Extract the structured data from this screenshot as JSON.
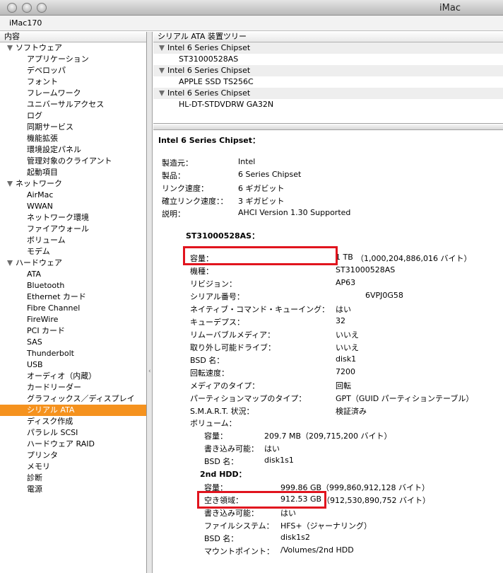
{
  "window": {
    "title": "iMac"
  },
  "machine_name": "iMac170",
  "sidebar": {
    "header": "内容",
    "rows": [
      {
        "type": "section",
        "label": "ソフトウェア"
      },
      {
        "type": "item",
        "label": "アプリケーション"
      },
      {
        "type": "item",
        "label": "デベロッパ"
      },
      {
        "type": "item",
        "label": "フォント"
      },
      {
        "type": "item",
        "label": "フレームワーク"
      },
      {
        "type": "item",
        "label": "ユニバーサルアクセス"
      },
      {
        "type": "item",
        "label": "ログ"
      },
      {
        "type": "item",
        "label": "同期サービス"
      },
      {
        "type": "item",
        "label": "機能拡張"
      },
      {
        "type": "item",
        "label": "環境設定パネル"
      },
      {
        "type": "item",
        "label": "管理対象のクライアント"
      },
      {
        "type": "item",
        "label": "起動項目"
      },
      {
        "type": "section",
        "label": "ネットワーク"
      },
      {
        "type": "item",
        "label": "AirMac"
      },
      {
        "type": "item",
        "label": "WWAN"
      },
      {
        "type": "item",
        "label": "ネットワーク環境"
      },
      {
        "type": "item",
        "label": "ファイアウォール"
      },
      {
        "type": "item",
        "label": "ボリューム"
      },
      {
        "type": "item",
        "label": "モデム"
      },
      {
        "type": "section",
        "label": "ハードウェア"
      },
      {
        "type": "item",
        "label": "ATA"
      },
      {
        "type": "item",
        "label": "Bluetooth"
      },
      {
        "type": "item",
        "label": "Ethernet カード"
      },
      {
        "type": "item",
        "label": "Fibre Channel"
      },
      {
        "type": "item",
        "label": "FireWire"
      },
      {
        "type": "item",
        "label": "PCI カード"
      },
      {
        "type": "item",
        "label": "SAS"
      },
      {
        "type": "item",
        "label": "Thunderbolt"
      },
      {
        "type": "item",
        "label": "USB"
      },
      {
        "type": "item",
        "label": "オーディオ（内蔵）"
      },
      {
        "type": "item",
        "label": "カードリーダー"
      },
      {
        "type": "item",
        "label": "グラフィックス／ディスプレイ"
      },
      {
        "type": "item",
        "label": "シリアル ATA",
        "selected": true
      },
      {
        "type": "item",
        "label": "ディスク作成"
      },
      {
        "type": "item",
        "label": "パラレル SCSI"
      },
      {
        "type": "item",
        "label": "ハードウェア RAID"
      },
      {
        "type": "item",
        "label": "プリンタ"
      },
      {
        "type": "item",
        "label": "メモリ"
      },
      {
        "type": "item",
        "label": "診断"
      },
      {
        "type": "item",
        "label": "電源"
      }
    ]
  },
  "device_tree": {
    "header": "シリアル ATA 装置ツリー",
    "rows": [
      {
        "type": "chip",
        "label": "Intel 6 Series Chipset"
      },
      {
        "type": "dev",
        "label": "ST31000528AS"
      },
      {
        "type": "chip",
        "label": "Intel 6 Series Chipset"
      },
      {
        "type": "dev",
        "label": "APPLE SSD TS256C"
      },
      {
        "type": "chip",
        "label": "Intel 6 Series Chipset"
      },
      {
        "type": "dev",
        "label": "HL-DT-STDVDRW  GA32N"
      }
    ]
  },
  "detail": {
    "title": "Intel 6 Series Chipset：",
    "chipset_props": [
      {
        "k": "製造元：",
        "v": "Intel"
      },
      {
        "k": "製品：",
        "v": "6 Series Chipset"
      },
      {
        "k": "リンク速度：",
        "v": "6 ギガビット"
      },
      {
        "k": "確立リンク速度：：",
        "v": "3 ギガビット"
      },
      {
        "k": "説明：",
        "v": "AHCI Version 1.30 Supported"
      }
    ],
    "disk_title": "ST31000528AS：",
    "disk_props": [
      {
        "k": "容量：",
        "v": "1 TB",
        "v2": "（1,000,204,886,016 バイト）"
      },
      {
        "k": "機種：",
        "v": "ST31000528AS"
      },
      {
        "k": "リビジョン：",
        "v": "AP63"
      },
      {
        "k": "シリアル番号：",
        "v": "6VPJ0G58"
      },
      {
        "k": "ネイティブ・コマンド・キューイング：",
        "v": "はい"
      },
      {
        "k": "キューデプス：",
        "v": "32"
      },
      {
        "k": "リムーバブルメディア：",
        "v": "いいえ"
      },
      {
        "k": "取り外し可能ドライブ：",
        "v": "いいえ"
      },
      {
        "k": "BSD 名：",
        "v": "disk1"
      },
      {
        "k": "回転速度：",
        "v": "7200"
      },
      {
        "k": "メディアのタイプ：",
        "v": "回転"
      },
      {
        "k": "パーティションマップのタイプ：",
        "v": "GPT（GUID パーティションテーブル）"
      },
      {
        "k": "S.M.A.R.T. 状況：",
        "v": "検証済み"
      }
    ],
    "volumes_label": "ボリューム：",
    "vol1_props": [
      {
        "k": "容量：",
        "v": "209.7 MB（209,715,200 バイト）"
      },
      {
        "k": "書き込み可能：",
        "v": "はい"
      },
      {
        "k": "BSD 名：",
        "v": "disk1s1"
      }
    ],
    "vol2_title": "2nd HDD：",
    "vol2_props": [
      {
        "k": "容量：",
        "v": "999.86 GB（999,860,912,128 バイト）"
      },
      {
        "k": "空き領域：",
        "v": "912.53 GB",
        "v2": "（912,530,890,752 バイト）"
      },
      {
        "k": "書き込み可能：",
        "v": "はい"
      },
      {
        "k": "ファイルシステム：",
        "v": "HFS+（ジャーナリング）"
      },
      {
        "k": "BSD 名：",
        "v": "disk1s2"
      },
      {
        "k": "マウントポイント：",
        "v": "/Volumes/2nd HDD"
      }
    ]
  },
  "colors": {
    "selection": "#f5921e",
    "highlight": "#e1141e"
  }
}
